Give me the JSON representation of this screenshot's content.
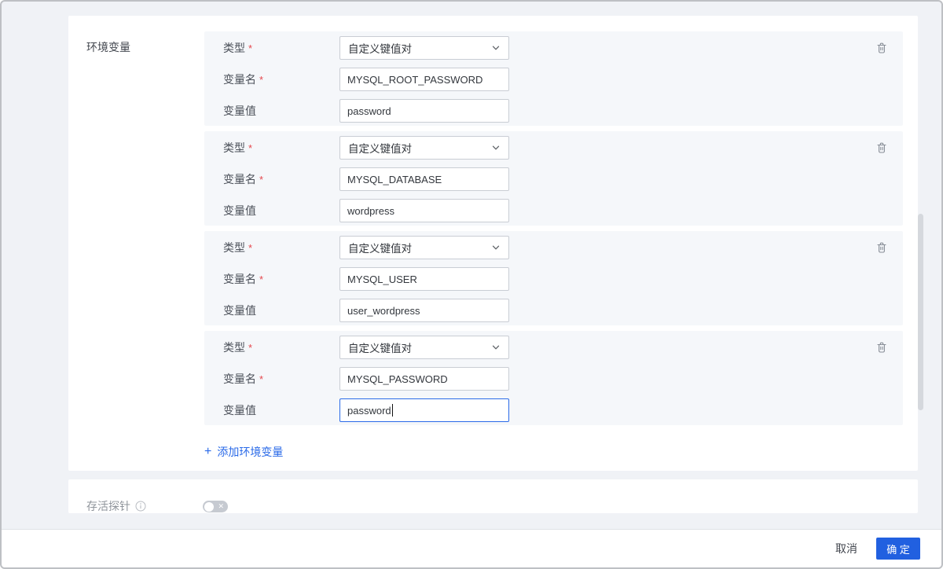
{
  "colors": {
    "accent": "#2a6ae8",
    "confirm_button": "#2160e0",
    "block_bg": "#f5f7fa"
  },
  "section": {
    "label": "环境变量",
    "required_mark": "*"
  },
  "env_blocks": [
    {
      "type_label": "类型",
      "type_value": "自定义键值对",
      "name_label": "变量名",
      "name_value": "MYSQL_ROOT_PASSWORD",
      "value_label": "变量值",
      "value_value": "password"
    },
    {
      "type_label": "类型",
      "type_value": "自定义键值对",
      "name_label": "变量名",
      "name_value": "MYSQL_DATABASE",
      "value_label": "变量值",
      "value_value": "wordpress"
    },
    {
      "type_label": "类型",
      "type_value": "自定义键值对",
      "name_label": "变量名",
      "name_value": "MYSQL_USER",
      "value_label": "变量值",
      "value_value": "user_wordpress"
    },
    {
      "type_label": "类型",
      "type_value": "自定义键值对",
      "name_label": "变量名",
      "name_value": "MYSQL_PASSWORD",
      "value_label": "变量值",
      "value_value": "password"
    }
  ],
  "add_env": {
    "plus": "+",
    "label": "添加环境变量"
  },
  "probe": {
    "label": "存活探针",
    "toggle_state": "off",
    "toggle_off_glyph": "✕"
  },
  "footer": {
    "cancel_label": "取消",
    "confirm_label": "确 定"
  }
}
